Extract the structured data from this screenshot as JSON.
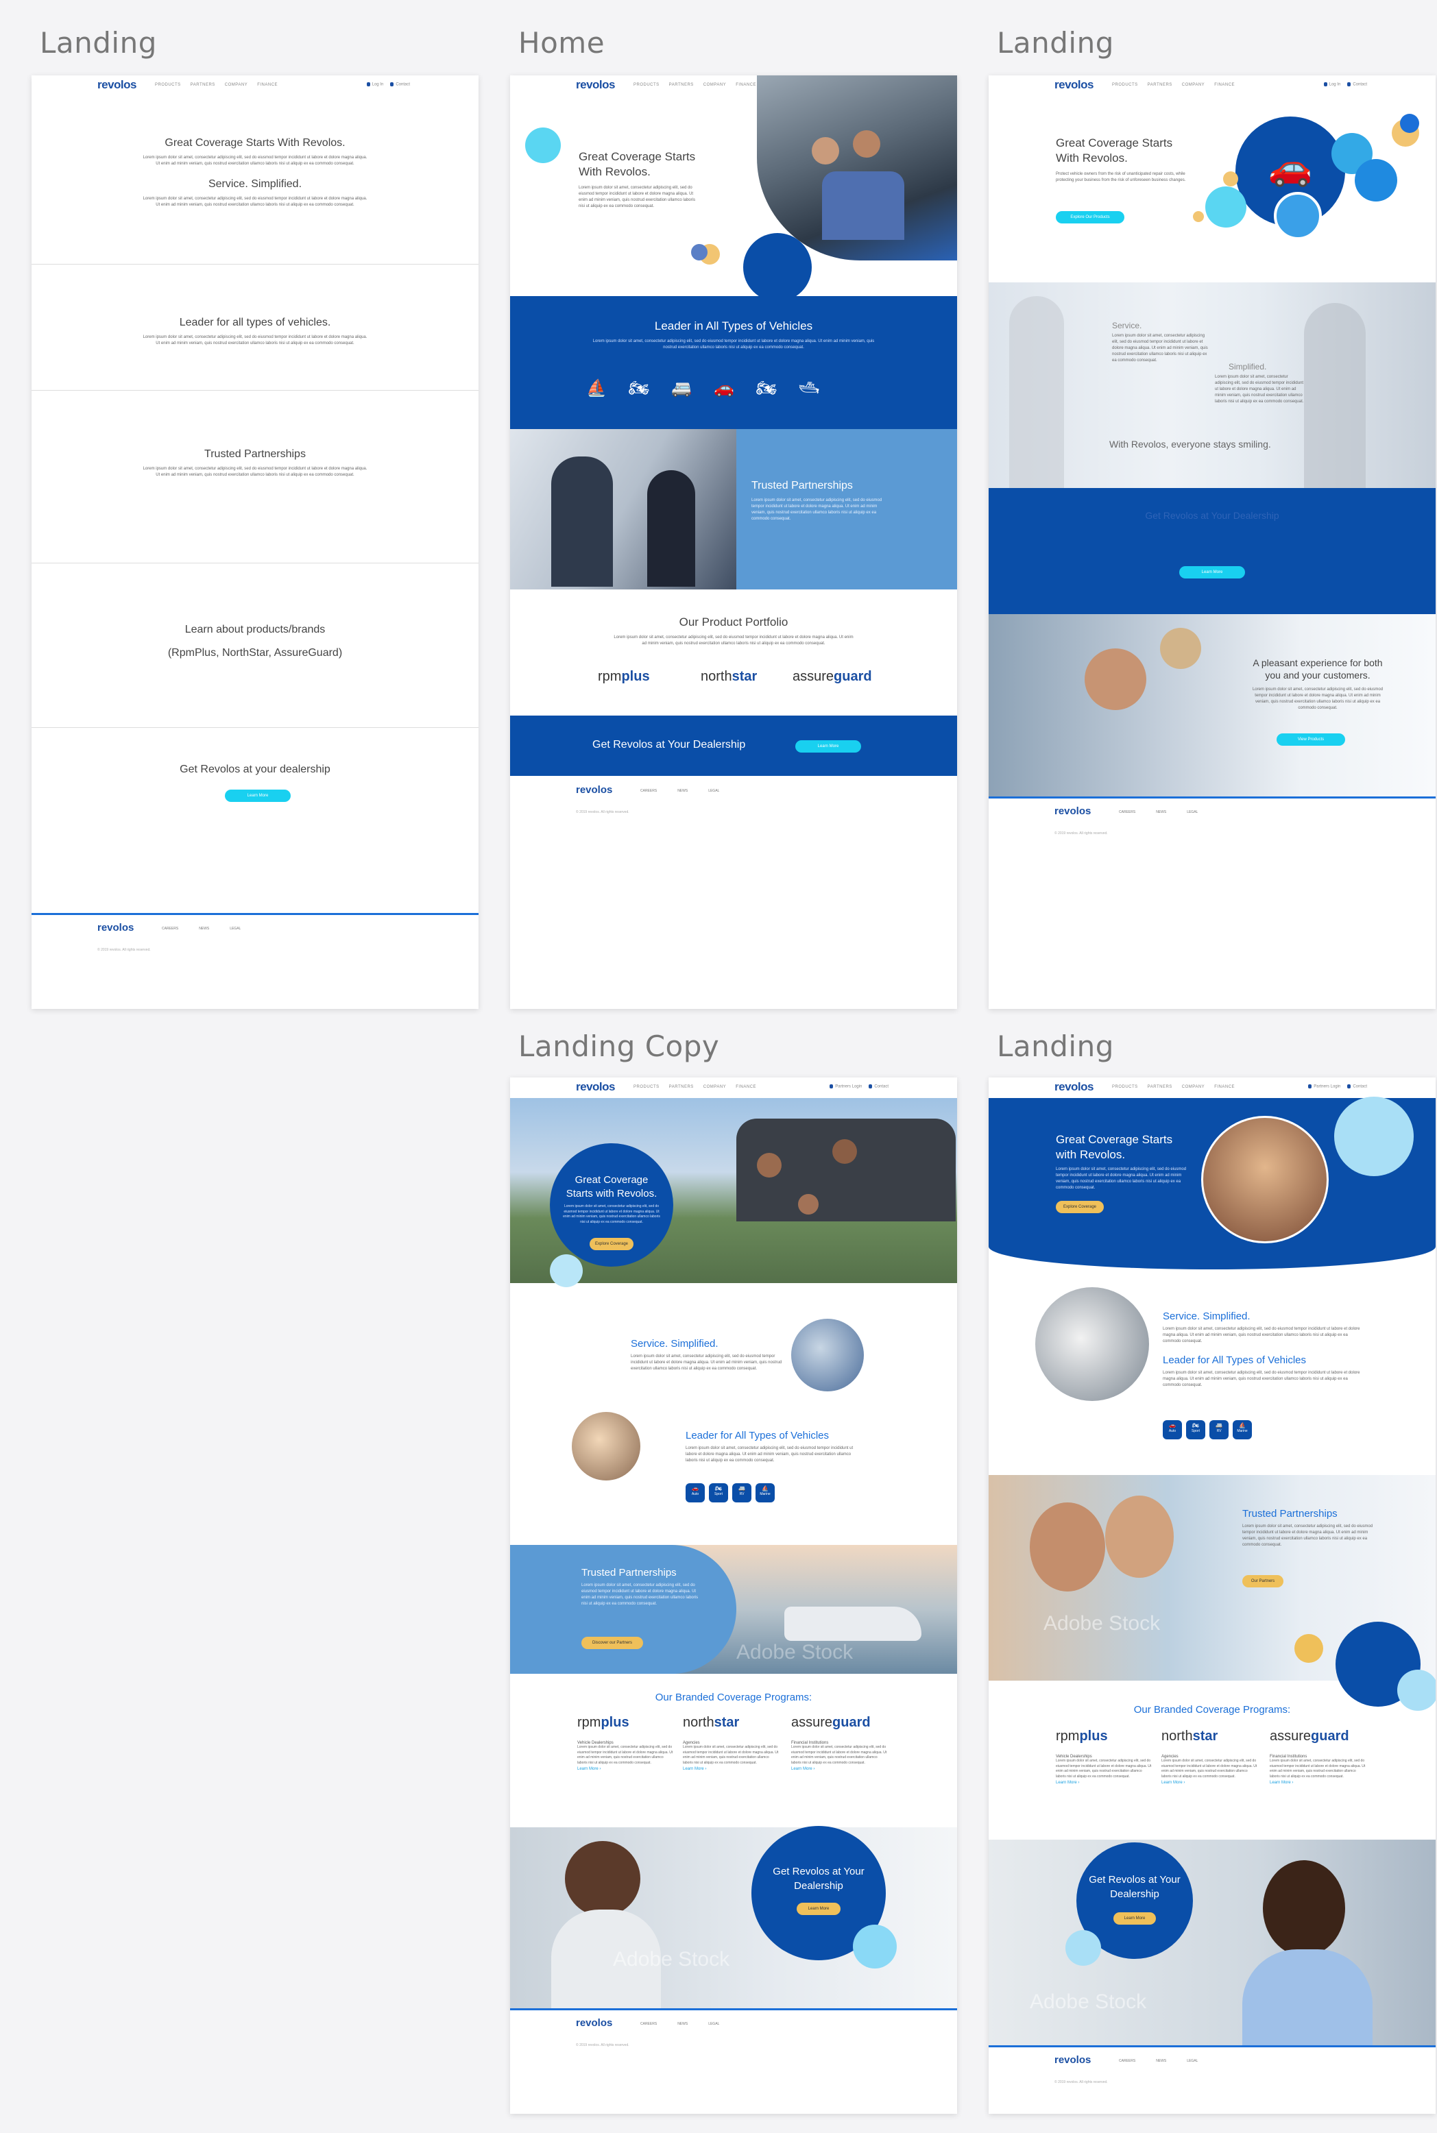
{
  "frames": [
    {
      "title": "Landing"
    },
    {
      "title": "Home"
    },
    {
      "title": "Landing"
    },
    {
      "title": "Landing Copy"
    },
    {
      "title": "Landing"
    }
  ],
  "nav": {
    "logo": "revolos",
    "links": [
      "PRODUCTS",
      "PARTNERS",
      "COMPANY",
      "FINANCE"
    ],
    "login": "Log In",
    "contact": "Contact",
    "partners_login": "Partners Login"
  },
  "footer": {
    "logo": "revolos",
    "links": [
      "CAREERS",
      "NEWS",
      "LEGAL"
    ],
    "copyright": "© 2019 revolos. All rights reserved."
  },
  "lorem": "Lorem ipsum dolor sit amet, consectetur adipiscing elit, sed do eiusmod tempor incididunt ut labore et dolore magna aliqua. Ut enim ad minim veniam, quis nostrud exercitation ullamco laboris nisi ut aliquip ex ea commodo consequat.",
  "wire": {
    "s1_title": "Great Coverage Starts With Revolos.",
    "s1_sub": "Service. Simplified.",
    "s2_title": "Leader for all types of vehicles.",
    "s3_title": "Trusted Partnerships",
    "s4_title": "Learn about products/brands",
    "s4_sub": "(RpmPlus, NorthStar, AssureGuard)",
    "s5_title": "Get Revolos at your dealership",
    "s5_btn": "Learn More"
  },
  "home": {
    "hero_title": "Great Coverage Starts With Revolos.",
    "band_title": "Leader in All Types of Vehicles",
    "vehicles": [
      "⛵",
      "🏍",
      "🚐",
      "🚗",
      "🏍",
      "🛥"
    ],
    "partner_title": "Trusted Partnerships",
    "portfolio_title": "Our Product Portfolio",
    "cta_title": "Get Revolos at Your Dealership",
    "cta_btn": "Learn More"
  },
  "landing3": {
    "hero_title": "Great Coverage Starts With Revolos.",
    "hero_text": "Protect vehicle owners from the risk of unanticipated repair costs, while protecting your business from the risk of unforeseen business changes.",
    "hero_btn": "Explore Our Products",
    "service": "Service.",
    "simplified": "Simplified.",
    "smiling": "With Revolos, everyone stays smiling.",
    "faded": "Get Revolos at Your Dealership",
    "band_btn": "Learn More",
    "pleasant": "A pleasant experience for both you and your customers.",
    "pleasant_btn": "View Products"
  },
  "copy": {
    "hero_title": "Great Coverage Starts with Revolos.",
    "hero_btn": "Explore Coverage",
    "service_title": "Service. Simplified.",
    "leader_title": "Leader for All Types of Vehicles",
    "tiles": [
      "Auto",
      "Sport",
      "RV",
      "Marine"
    ],
    "partner_title": "Trusted Partnerships",
    "partner_btn": "Discover our Partners",
    "programs_title": "Our Branded Coverage Programs:",
    "programs": [
      {
        "cat": "Vehicle Dealerships",
        "link": "Learn More ›"
      },
      {
        "cat": "Agencies",
        "link": "Learn More ›"
      },
      {
        "cat": "Financial Institutions",
        "link": "Learn More ›"
      }
    ],
    "cta_title": "Get Revolos at Your Dealership",
    "cta_btn": "Learn More",
    "watermark": "Adobe Stock"
  },
  "landing5": {
    "hero_title": "Great Coverage Starts with Revolos.",
    "hero_btn": "Explore Coverage",
    "service_title": "Service. Simplified.",
    "leader_title": "Leader for All Types of Vehicles",
    "tiles": [
      "Auto",
      "Sport",
      "RV",
      "Marine"
    ],
    "partner_title": "Trusted Partnerships",
    "partner_btn": "Our Partners",
    "programs_title": "Our Branded Coverage Programs:",
    "cta_title": "Get Revolos at Your Dealership",
    "cta_btn": "Learn More",
    "watermark": "Adobe Stock"
  },
  "brands": {
    "rpm_a": "rpm",
    "rpm_b": "plus",
    "north_a": "north",
    "north_b": "star",
    "assure_a": "assure",
    "assure_b": "guard"
  }
}
